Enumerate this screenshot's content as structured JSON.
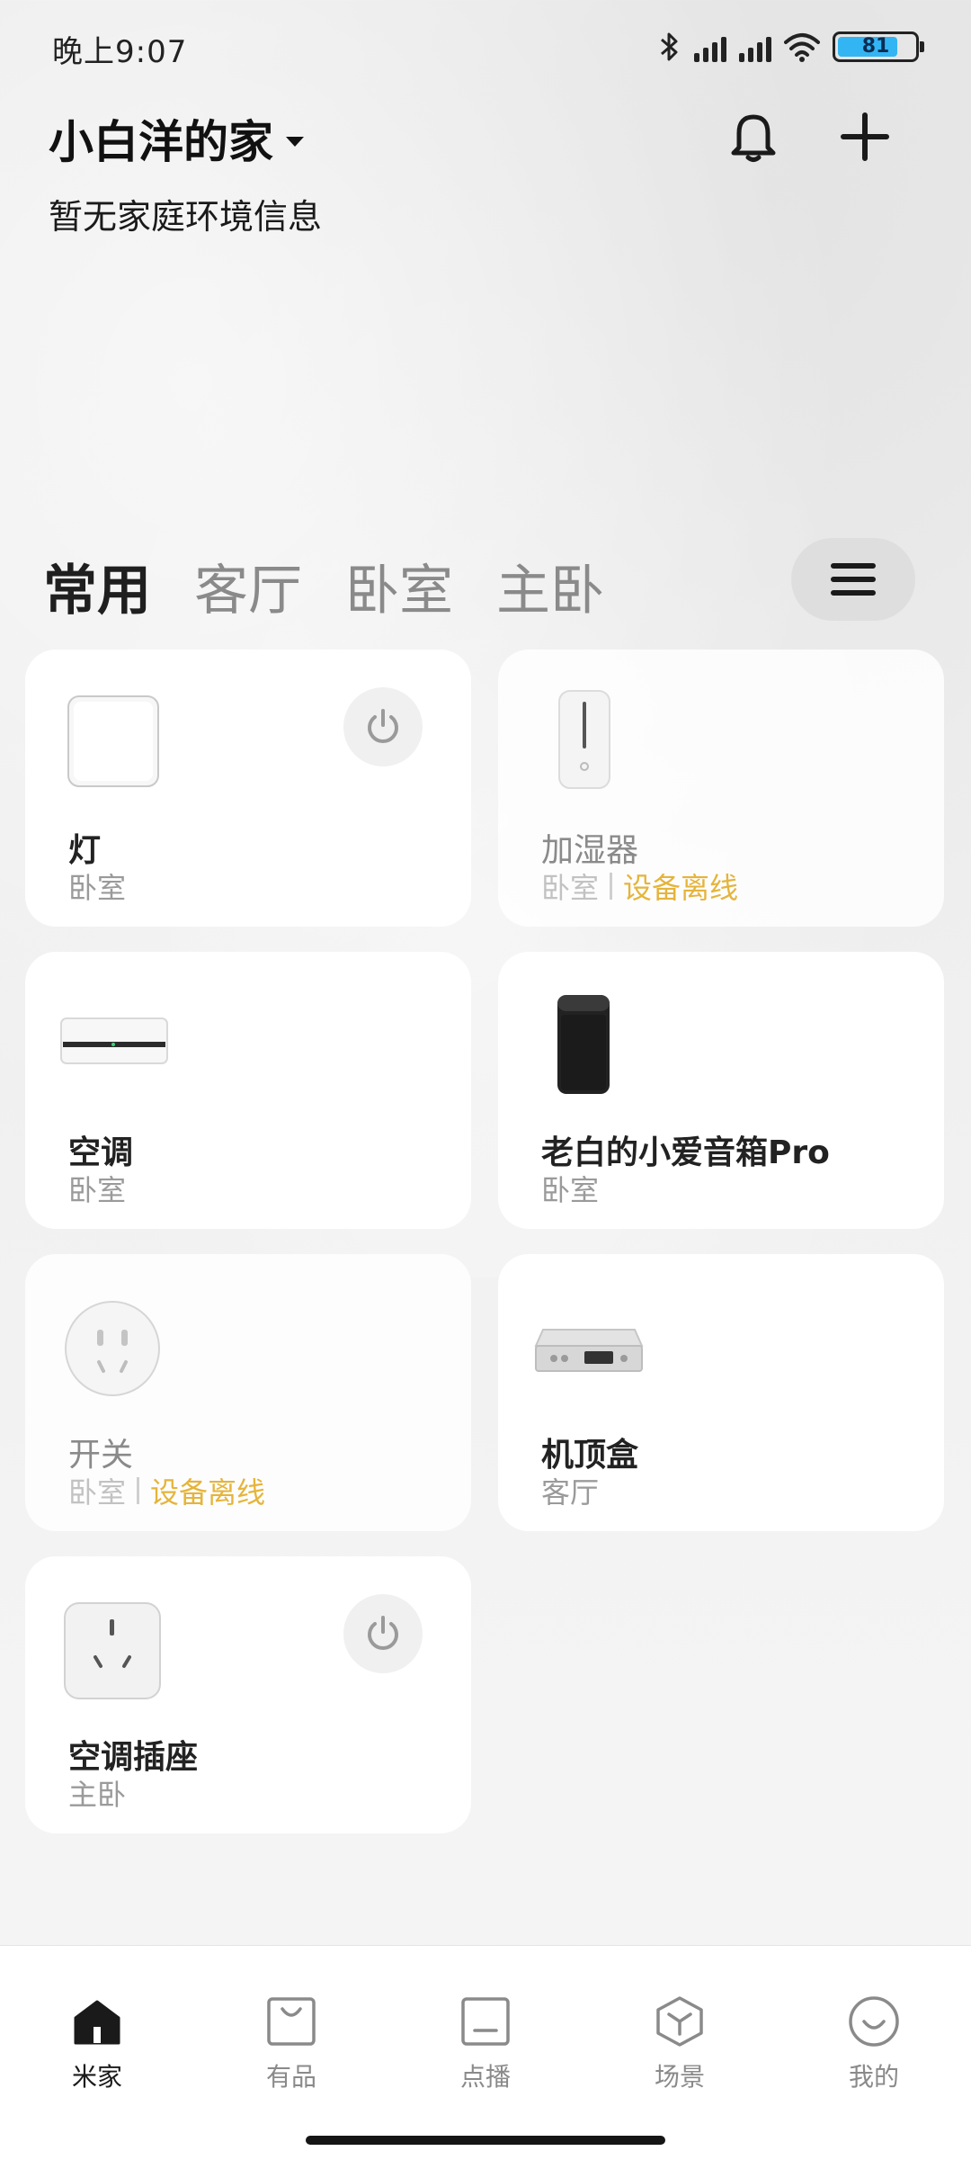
{
  "status_bar": {
    "time": "晚上9:07",
    "battery": "81"
  },
  "header": {
    "home_name": "小白洋的家",
    "env_info": "暂无家庭环境信息"
  },
  "tabs": [
    {
      "label": "常用"
    },
    {
      "label": "客厅"
    },
    {
      "label": "卧室"
    },
    {
      "label": "主卧"
    }
  ],
  "devices": [
    {
      "name": "灯",
      "room": "卧室",
      "status": ""
    },
    {
      "name": "加湿器",
      "room": "卧室",
      "status": "设备离线"
    },
    {
      "name": "空调",
      "room": "卧室",
      "status": ""
    },
    {
      "name": "老白的小爱音箱Pro",
      "room": "卧室",
      "status": ""
    },
    {
      "name": "开关",
      "room": "卧室",
      "status": "设备离线"
    },
    {
      "name": "机顶盒",
      "room": "客厅",
      "status": ""
    },
    {
      "name": "空调插座",
      "room": "主卧",
      "status": ""
    }
  ],
  "bottom_nav": [
    {
      "label": "米家",
      "icon": "home-icon"
    },
    {
      "label": "有品",
      "icon": "shopping-bag-icon"
    },
    {
      "label": "点播",
      "icon": "media-icon"
    },
    {
      "label": "场景",
      "icon": "scene-cube-icon"
    },
    {
      "label": "我的",
      "icon": "smile-icon"
    }
  ],
  "colors": {
    "offline": "#e5b43b",
    "battery_fill": "#33b5f3",
    "active_text": "#1a1a1a",
    "inactive_text": "#8a8a8a"
  }
}
